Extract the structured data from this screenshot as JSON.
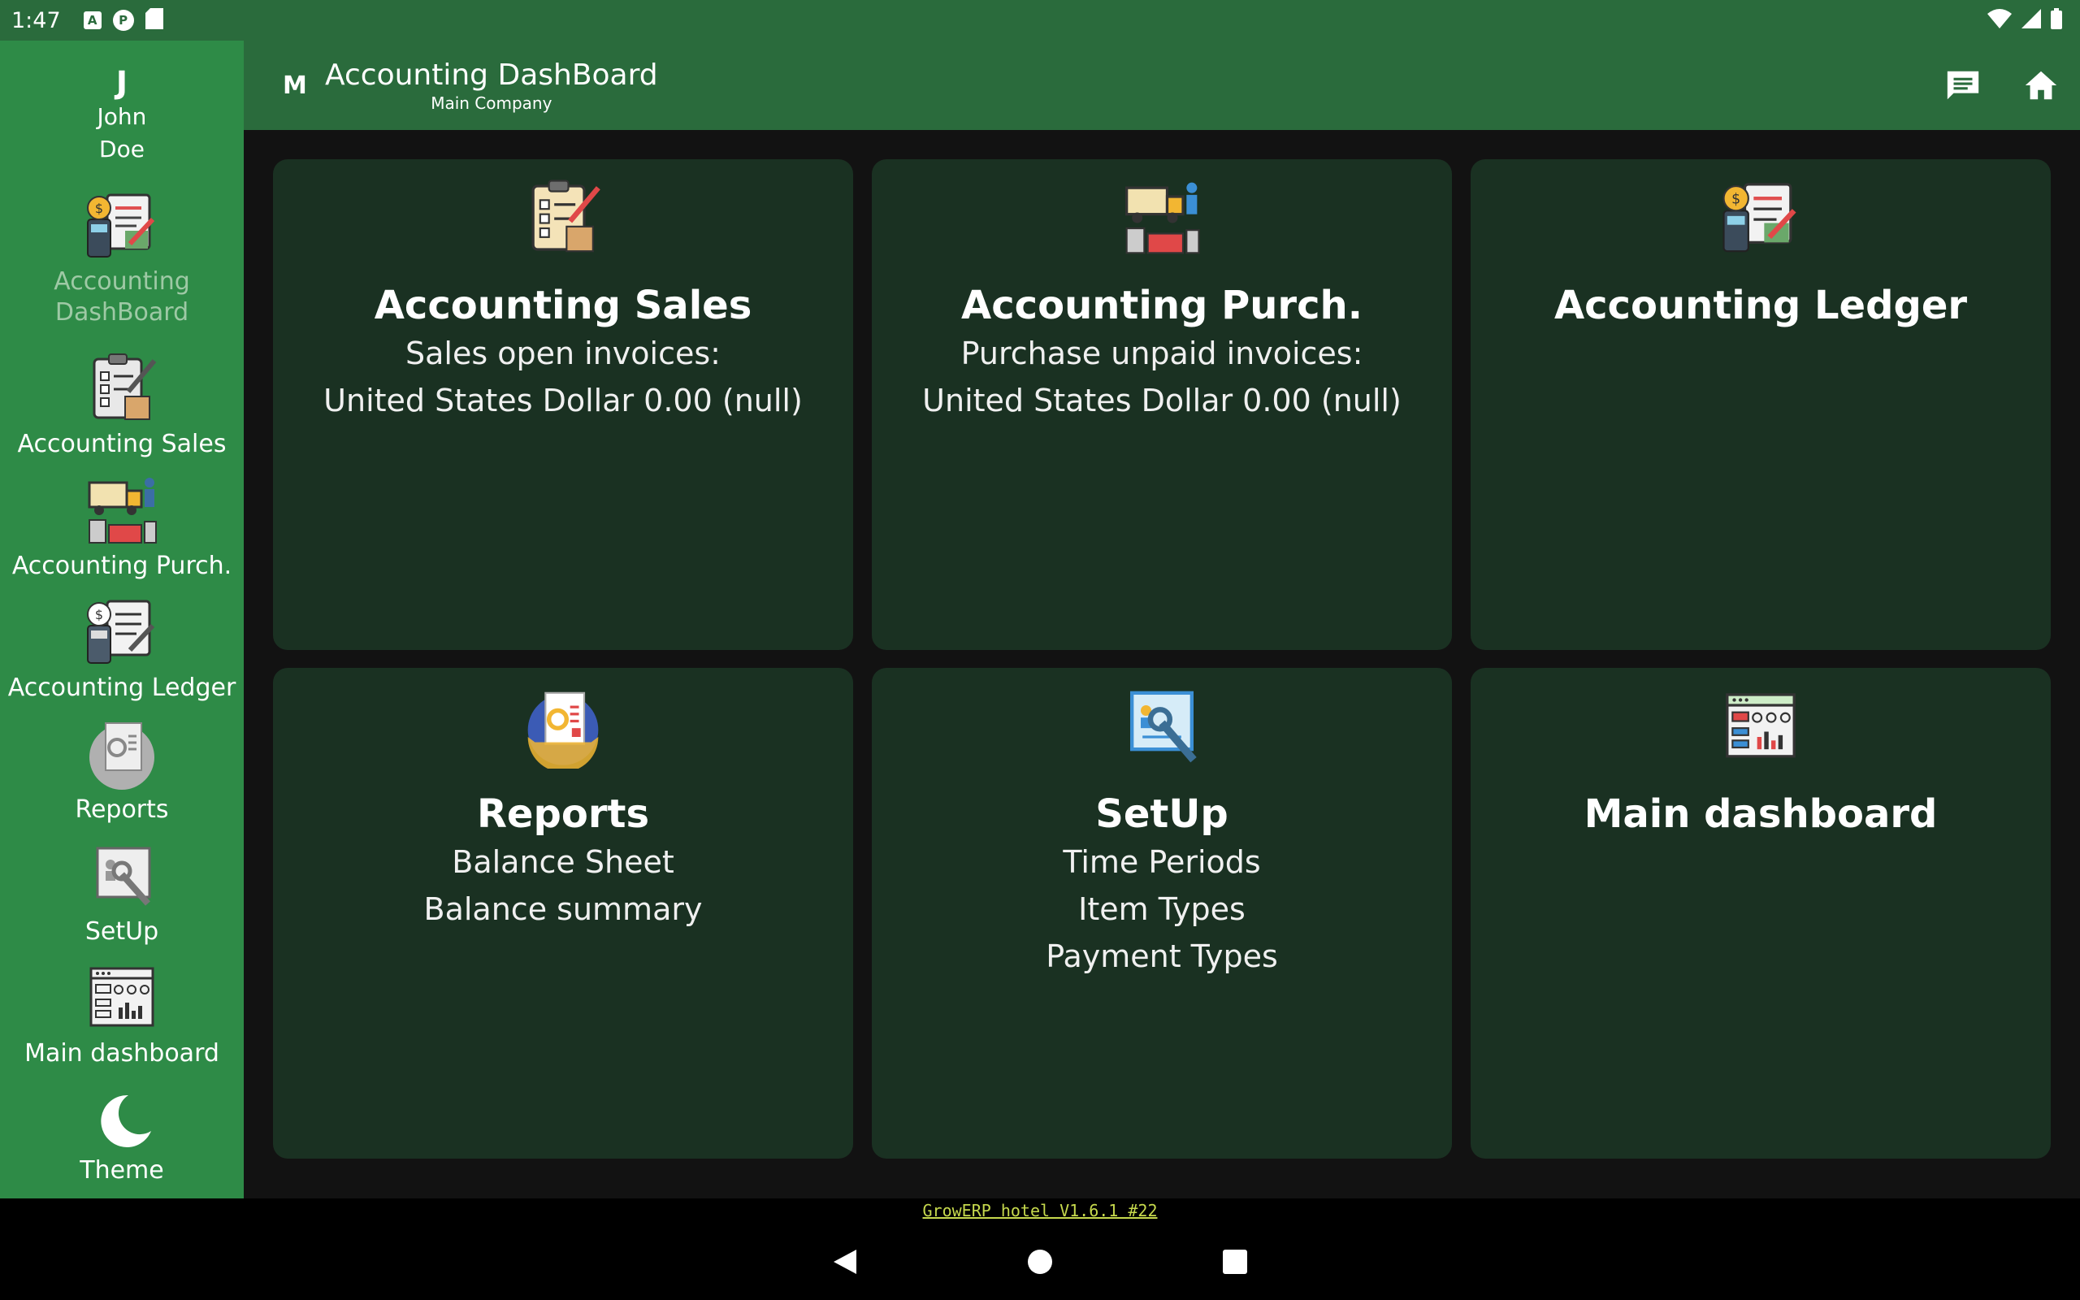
{
  "status_bar": {
    "time": "1:47",
    "left_icons": [
      "a-icon",
      "pinwheel-icon",
      "sd-card-icon"
    ],
    "right_icons": [
      "wifi-icon",
      "signal-icon",
      "battery-icon"
    ]
  },
  "user": {
    "initial": "J",
    "first_name": "John",
    "last_name": "Doe"
  },
  "rail": {
    "items": [
      {
        "label": "Accounting\nDashBoard",
        "icon": "accounting-dashboard-icon",
        "active": true
      },
      {
        "label": "Accounting Sales",
        "icon": "clipboard-sales-icon"
      },
      {
        "label": "Accounting Purch.",
        "icon": "truck-purchase-icon"
      },
      {
        "label": "Accounting Ledger",
        "icon": "ledger-icon"
      },
      {
        "label": "Reports",
        "icon": "reports-icon"
      },
      {
        "label": "SetUp",
        "icon": "setup-icon"
      },
      {
        "label": "Main dashboard",
        "icon": "dashboard-icon"
      },
      {
        "label": "Theme",
        "icon": "moon-icon"
      }
    ]
  },
  "appbar": {
    "company_initial": "M",
    "title": "Accounting DashBoard",
    "subtitle": "Main Company",
    "actions": [
      "chat-icon",
      "home-icon"
    ]
  },
  "cards": [
    {
      "title": "Accounting Sales",
      "lines": [
        "Sales open invoices:",
        "United States Dollar 0.00 (null)"
      ],
      "icon": "clipboard-sales-icon"
    },
    {
      "title": "Accounting Purch.",
      "lines": [
        "Purchase unpaid invoices:",
        "United States Dollar 0.00 (null)"
      ],
      "icon": "truck-purchase-icon"
    },
    {
      "title": "Accounting Ledger",
      "lines": [],
      "icon": "ledger-icon"
    },
    {
      "title": "Reports",
      "lines": [
        "Balance Sheet",
        "Balance summary"
      ],
      "icon": "reports-icon"
    },
    {
      "title": "SetUp",
      "lines": [
        "Time Periods",
        "Item Types",
        "Payment Types"
      ],
      "icon": "setup-icon"
    },
    {
      "title": "Main dashboard",
      "lines": [],
      "icon": "dashboard-icon"
    }
  ],
  "footer": {
    "version": "GrowERP hotel V1.6.1 #22"
  },
  "colors": {
    "app_bar": "#2a6b3c",
    "rail": "#2e8b47",
    "card": "#1a3122",
    "background": "#121212",
    "footer_link": "#c6d94d"
  }
}
